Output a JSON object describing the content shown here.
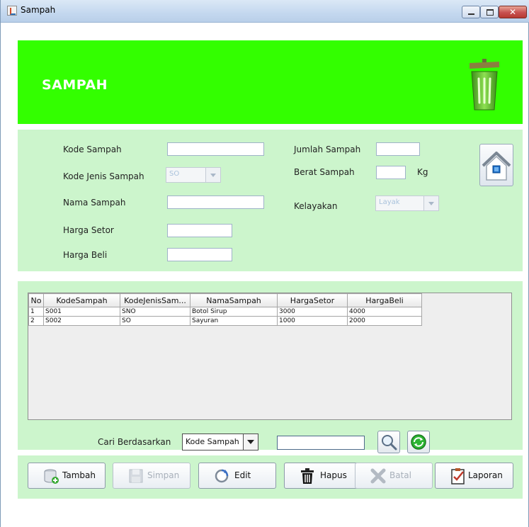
{
  "window": {
    "title": "Sampah"
  },
  "header": {
    "title": "SAMPAH"
  },
  "form": {
    "kode_sampah_label": "Kode Sampah",
    "kode_jenis_label": "Kode Jenis Sampah",
    "kode_jenis_value": "SO",
    "nama_label": "Nama Sampah",
    "harga_setor_label": "Harga Setor",
    "harga_beli_label": "Harga Beli",
    "jumlah_label": "Jumlah Sampah",
    "berat_label": "Berat Sampah",
    "berat_unit": "Kg",
    "kelayakan_label": "Kelayakan",
    "kelayakan_value": "Layak"
  },
  "table": {
    "columns": [
      "No",
      "KodeSampah",
      "KodeJenisSam...",
      "NamaSampah",
      "HargaSetor",
      "HargaBeli"
    ],
    "rows": [
      [
        "1",
        "S001",
        "SNO",
        "Botol Sirup",
        "3000",
        "4000"
      ],
      [
        "2",
        "S002",
        "SO",
        "Sayuran",
        "1000",
        "2000"
      ]
    ]
  },
  "search": {
    "label": "Cari Berdasarkan",
    "field_value": "Kode Sampah"
  },
  "buttons": {
    "tambah": "Tambah",
    "simpan": "Simpan",
    "edit": "Edit",
    "hapus": "Hapus",
    "batal": "Batal",
    "laporan": "Laporan"
  },
  "colors": {
    "header_green": "#33ff00",
    "panel_green": "#ccf5cc"
  }
}
